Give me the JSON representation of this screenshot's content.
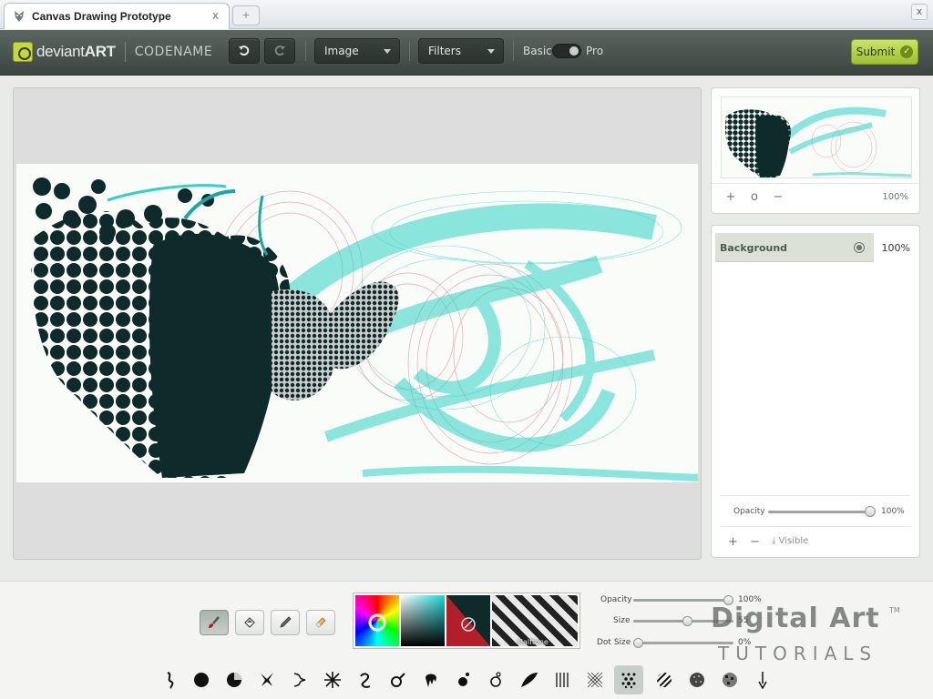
{
  "browser": {
    "tab_title": "Canvas Drawing Prototype",
    "tab_close": "x",
    "new_tab": "+",
    "window_close": "x"
  },
  "toolbar": {
    "logo_prefix": "deviant",
    "logo_bold": "ART",
    "codename": "CODENAME",
    "image_menu": "Image",
    "filters_menu": "Filters",
    "mode_basic": "Basic",
    "mode_pro": "Pro",
    "submit_label": "Submit"
  },
  "navigator": {
    "zoom": "100%",
    "zoom_in": "+",
    "zoom_reset": "o",
    "zoom_out": "−"
  },
  "layers": {
    "items": [
      {
        "name": "Background",
        "opacity": "100%"
      }
    ],
    "opacity_label": "Opacity",
    "opacity_value": "100%",
    "opacity_level": 1.0,
    "add": "+",
    "remove": "−",
    "visible_label": "Visible"
  },
  "brush_settings": {
    "opacity_label": "Opacity",
    "opacity_value": "100%",
    "opacity_level": 1.0,
    "size_label": "Size",
    "size_value": "55",
    "size_level": 0.55,
    "dot_label": "Dot Size",
    "dot_value": "0%",
    "dot_level": 0.0,
    "pattern_label": "Halftone"
  },
  "tools": [
    "brush-tool",
    "fill-tool",
    "eyedropper-tool",
    "eraser-tool"
  ],
  "colors": {
    "foreground": "#0e2a2a",
    "accent_red": "#b21f2a",
    "toolbar_dark": "#3c4541",
    "submit_green": "#a6c834",
    "cyan_stroke": "#2fd3c4",
    "pink_stroke": "#e88a93"
  },
  "watermark": {
    "title": "Digital Art",
    "subtitle": "TUTORIALS",
    "tm": "TM"
  }
}
